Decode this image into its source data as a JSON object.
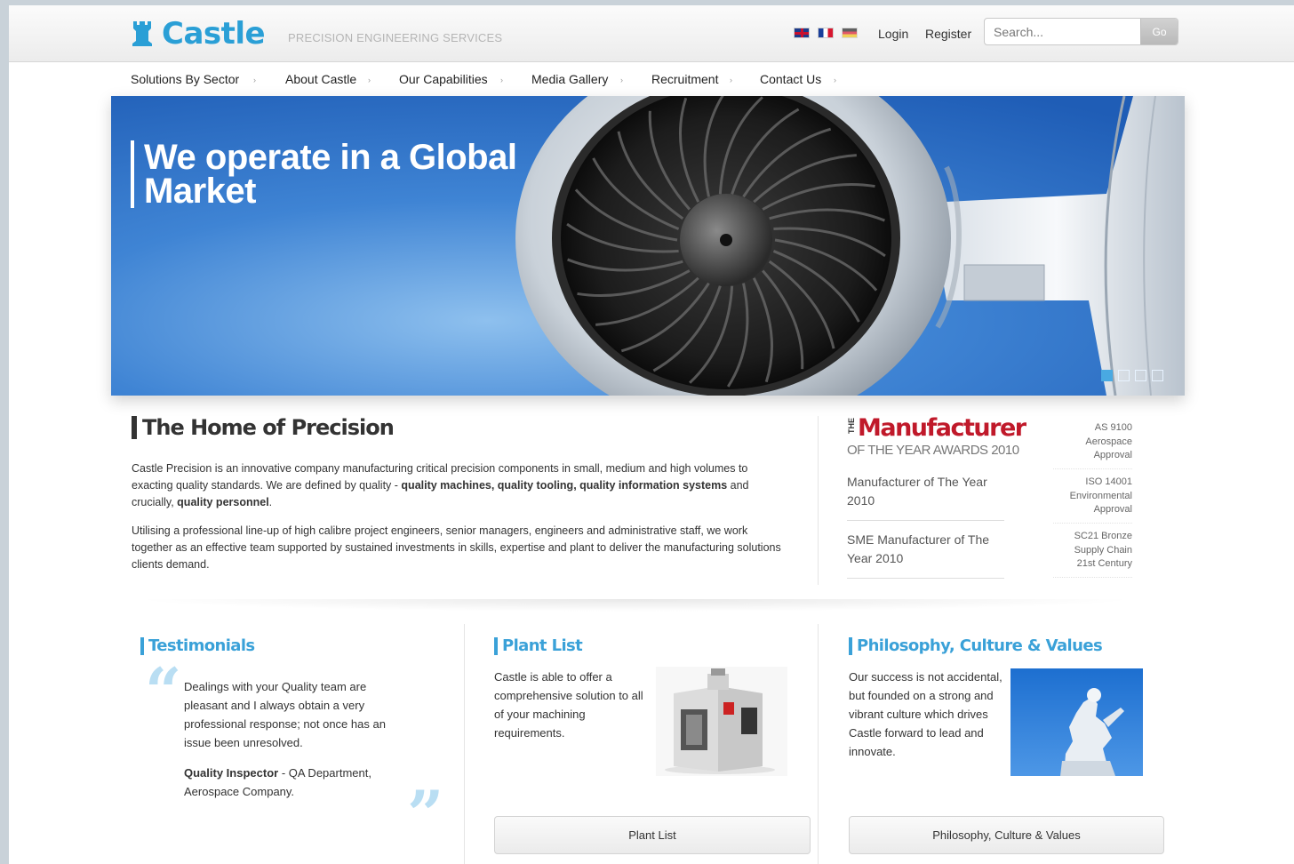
{
  "header": {
    "brand": "Castle",
    "tagline": "PRECISION ENGINEERING SERVICES",
    "languages": [
      "English",
      "French",
      "German"
    ],
    "login": "Login",
    "register": "Register",
    "search_placeholder": "Search...",
    "search_button": "Go"
  },
  "nav": {
    "items": [
      {
        "label": "Solutions By Sector"
      },
      {
        "label": "About Castle"
      },
      {
        "label": "Our Capabilities"
      },
      {
        "label": "Media Gallery"
      },
      {
        "label": "Recruitment"
      },
      {
        "label": "Contact Us"
      }
    ],
    "arrow": "›"
  },
  "hero": {
    "title": "We operate in a Global Market",
    "slide_count": 4,
    "active_slide": 1
  },
  "home": {
    "title": "The Home of Precision",
    "para1_a": "Castle Precision is an innovative company manufacturing critical precision components in small, medium and high volumes to exacting quality standards. We are defined by quality - ",
    "para1_b": "quality machines, quality tooling, quality information systems",
    "para1_c": " and crucially, ",
    "para1_d": "quality personnel",
    "para1_e": ".",
    "para2": "Utilising a professional line-up of high calibre project engineers, senior managers, engineers and administrative staff, we work together as an effective team supported by sustained investments in skills, expertise and plant to deliver the manufacturing solutions clients demand."
  },
  "awards": {
    "logo_the": "THE",
    "logo_main": "Manufacturer",
    "logo_sub": "OF THE YEAR AWARDS 2010",
    "items": [
      {
        "label": "Manufacturer of The Year 2010"
      },
      {
        "label": "SME Manufacturer of The Year 2010"
      }
    ],
    "certs": [
      {
        "label": "AS 9100 Aerospace Approval"
      },
      {
        "label": "ISO 14001 Environmental Approval"
      },
      {
        "label": "SC21 Bronze Supply Chain 21st Century"
      }
    ]
  },
  "testimonials": {
    "title": "Testimonials",
    "quote": "Dealings with your Quality team are pleasant and I always obtain a very professional response; not once has an issue been unresolved.",
    "author_bold": "Quality Inspector",
    "author_rest": " - QA Department, Aerospace Company."
  },
  "plant": {
    "title": "Plant List",
    "text": "Castle is able to offer a comprehensive solution to all of your machining requirements.",
    "button": "Plant List"
  },
  "philosophy": {
    "title": "Philosophy, Culture & Values",
    "text": "Our success is not accidental, but founded on a strong and vibrant culture which drives Castle forward to lead and innovate.",
    "button": "Philosophy, Culture & Values"
  },
  "colors": {
    "brand": "#2a9fd6",
    "accent": "#3aa1d8",
    "award_red": "#c0192a"
  }
}
